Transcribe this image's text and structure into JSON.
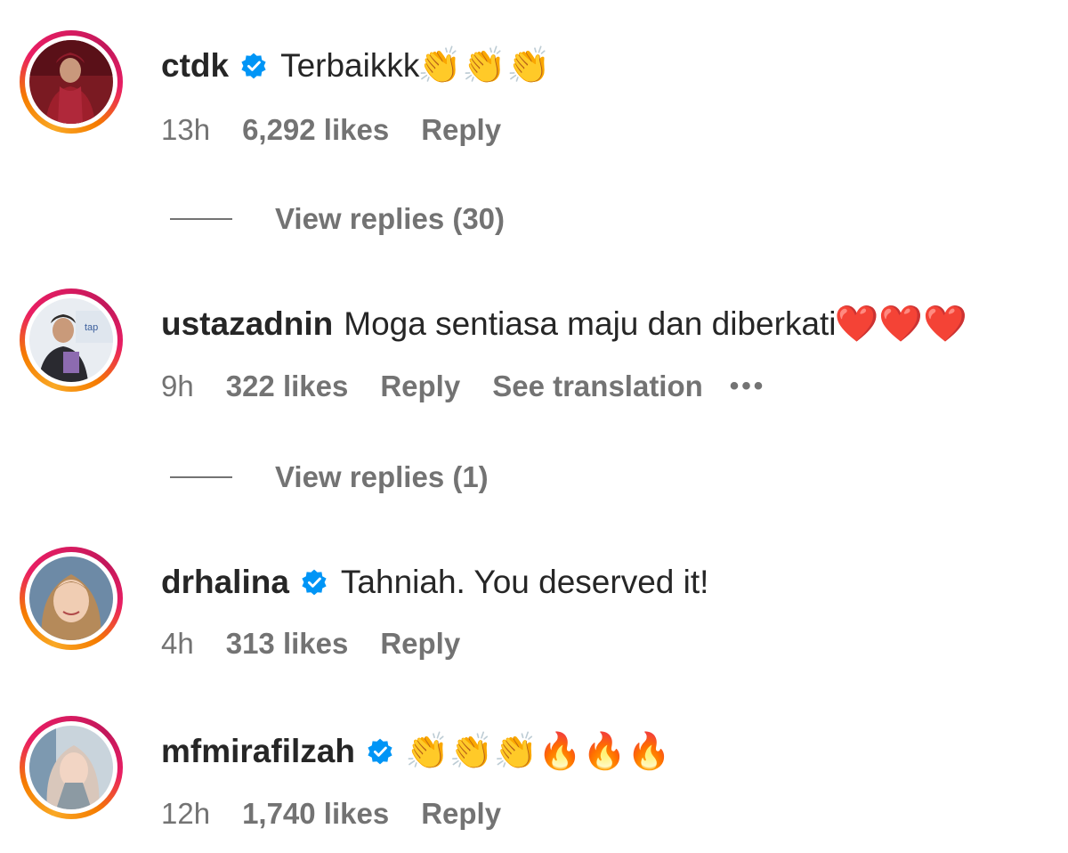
{
  "comments": [
    {
      "username": "ctdk",
      "verified": true,
      "text": "Terbaikkk",
      "emoji": "👏👏👏",
      "time": "13h",
      "likes": "6,292 likes",
      "reply": "Reply",
      "view_replies": "View replies (30)"
    },
    {
      "username": "ustazadnin",
      "verified": false,
      "text": "Moga sentiasa maju dan diberkati",
      "emoji": "❤️❤️❤️",
      "time": "9h",
      "likes": "322 likes",
      "reply": "Reply",
      "translation": "See translation",
      "more": "•••",
      "view_replies": "View replies (1)"
    },
    {
      "username": "drhalina",
      "verified": true,
      "text": "Tahniah. You deserved it!",
      "emoji": "",
      "time": "4h",
      "likes": "313 likes",
      "reply": "Reply"
    },
    {
      "username": "mfmirafilzah",
      "verified": true,
      "text": "",
      "emoji": "👏👏👏🔥🔥🔥",
      "time": "12h",
      "likes": "1,740 likes",
      "reply": "Reply"
    }
  ],
  "colors": {
    "verified_badge": "#0095f6",
    "meta_text": "#737373",
    "primary_text": "#262626"
  },
  "icons": {
    "verified": "verified-badge-icon",
    "more": "more-options-icon"
  }
}
